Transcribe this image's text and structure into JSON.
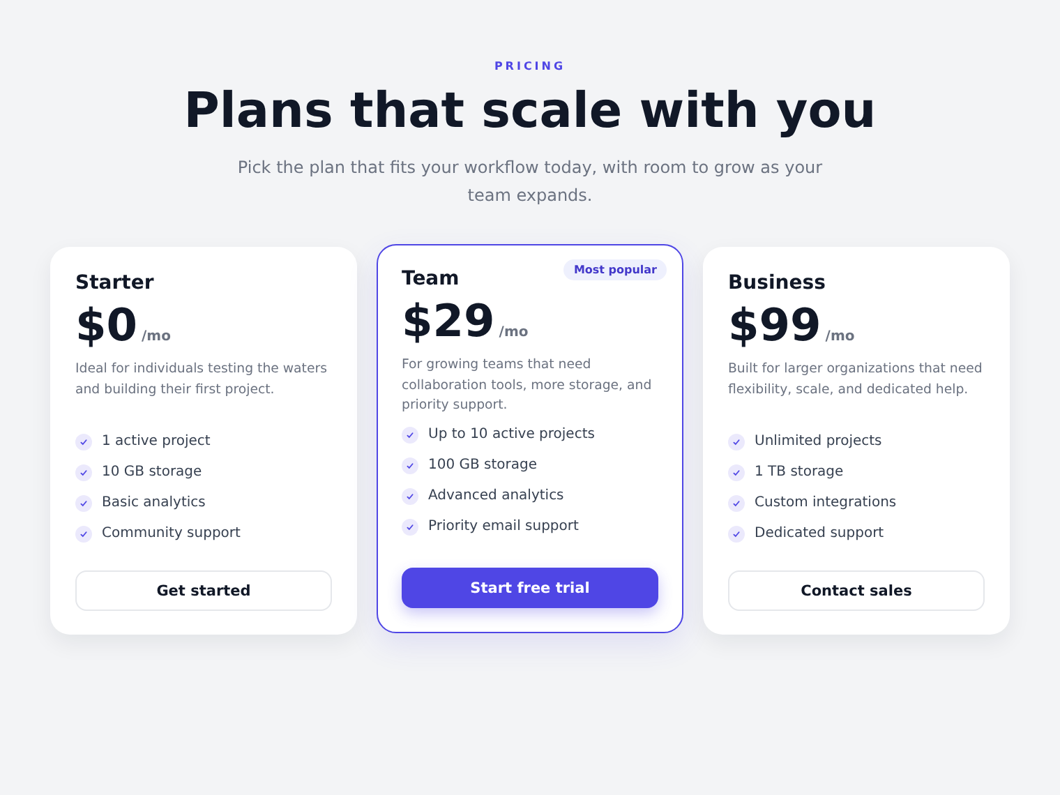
{
  "header": {
    "eyebrow": "PRICING",
    "title": "Plans that scale with you",
    "subtitle": "Pick the plan that fits your workflow today, with room to grow as your team expands."
  },
  "plans": [
    {
      "name": "Starter",
      "price": "$0",
      "period": "/mo",
      "description": "Ideal for individuals testing the waters and building their first project.",
      "featured": false,
      "features": [
        "1 active project",
        "10 GB storage",
        "Basic analytics",
        "Community support"
      ],
      "button": "Get started"
    },
    {
      "name": "Team",
      "badge": "Most popular",
      "price": "$29",
      "period": "/mo",
      "description": "For growing teams that need collaboration tools, more storage, and priority support.",
      "featured": true,
      "features": [
        "Up to 10 active projects",
        "100 GB storage",
        "Advanced analytics",
        "Priority email support"
      ],
      "button": "Start free trial"
    },
    {
      "name": "Business",
      "price": "$99",
      "period": "/mo",
      "description": "Built for larger organizations that need flexibility, scale, and dedicated help.",
      "featured": false,
      "features": [
        "Unlimited projects",
        "1 TB storage",
        "Custom integrations",
        "Dedicated support"
      ],
      "button": "Contact sales"
    }
  ]
}
